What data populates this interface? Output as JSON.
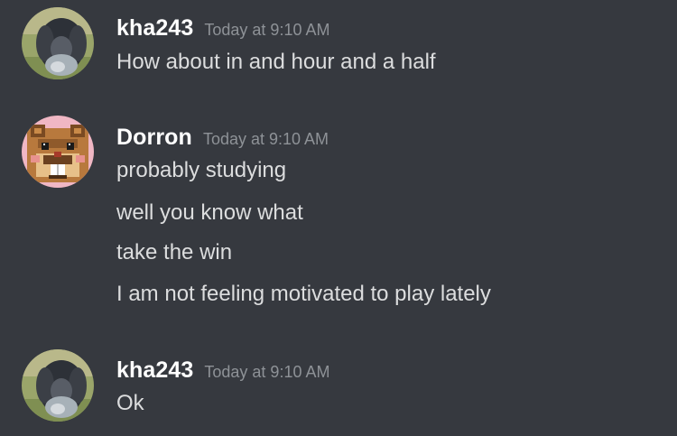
{
  "messages": [
    {
      "author": "kha243",
      "timestamp": "Today at 9:10 AM",
      "avatar_icon": "puppy-photo-avatar",
      "lines": [
        "How about in and hour and a half"
      ]
    },
    {
      "author": "Dorron",
      "timestamp": "Today at 9:10 AM",
      "avatar_icon": "pixel-bidoof-avatar",
      "lines": [
        "probably studying",
        "well you know what",
        "take the win",
        "I am not feeling motivated to play lately"
      ]
    },
    {
      "author": "kha243",
      "timestamp": "Today at 9:10 AM",
      "avatar_icon": "puppy-photo-avatar",
      "lines": [
        "Ok"
      ]
    }
  ],
  "colors": {
    "background": "#36393f",
    "username": "#ffffff",
    "timestamp": "#8e9297",
    "message_text": "#dcddde"
  }
}
